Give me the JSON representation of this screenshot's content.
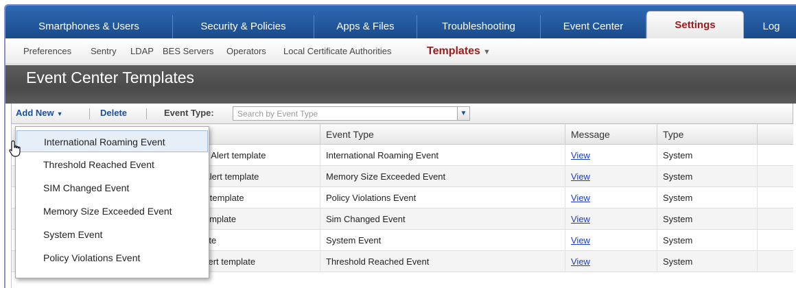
{
  "topnav": {
    "tabs": [
      {
        "label": "Smartphones & Users"
      },
      {
        "label": "Security & Policies"
      },
      {
        "label": "Apps & Files"
      },
      {
        "label": "Troubleshooting"
      },
      {
        "label": "Event Center"
      },
      {
        "label": "Settings"
      },
      {
        "label": "Log"
      }
    ],
    "active": "Settings"
  },
  "subnav": {
    "items": [
      {
        "label": "Preferences"
      },
      {
        "label": "Sentry"
      },
      {
        "label": "LDAP"
      },
      {
        "label": "BES Servers"
      },
      {
        "label": "Operators"
      },
      {
        "label": "Local Certificate Authorities"
      },
      {
        "label": "Templates"
      }
    ],
    "active": "Templates"
  },
  "page": {
    "title": "Event Center Templates"
  },
  "toolbar": {
    "add_new_label": "Add New",
    "delete_label": "Delete",
    "event_type_label": "Event Type:",
    "search_placeholder": "Search by Event Type"
  },
  "table": {
    "columns": [
      "Event Type",
      "Message",
      "Type"
    ],
    "rows": [
      {
        "name_fragment": "ing Alert template",
        "event_type": "International Roaming Event",
        "message": "View",
        "type": "System"
      },
      {
        "name_fragment": "d Alert template",
        "event_type": "Memory Size Exceeded Event",
        "message": "View",
        "type": "System"
      },
      {
        "name_fragment": "ert template",
        "event_type": "Policy Violations Event",
        "message": "View",
        "type": "System"
      },
      {
        "name_fragment": "t template",
        "event_type": "Sim Changed Event",
        "message": "View",
        "type": "System"
      },
      {
        "name_fragment": "plate",
        "event_type": "System Event",
        "message": "View",
        "type": "System"
      },
      {
        "id": "N/A",
        "name_fragment": "Default Threshold Reached Alert template",
        "event_type": "Threshold Reached Event",
        "message": "View",
        "type": "System"
      }
    ]
  },
  "add_new_menu": {
    "items": [
      {
        "label": "International Roaming Event"
      },
      {
        "label": "Threshold Reached Event"
      },
      {
        "label": "SIM Changed Event"
      },
      {
        "label": "Memory Size Exceeded Event"
      },
      {
        "label": "System Event"
      },
      {
        "label": "Policy Violations Event"
      }
    ],
    "hovered": "International Roaming Event"
  },
  "colors": {
    "nav_blue": "#1f5aa5",
    "active_tab_text": "#9b1b1b",
    "link_blue": "#1a3fc4",
    "title_band": "#4f4f4f"
  },
  "icons": [
    "hand-pointer-icon",
    "chevron-down-icon",
    "dropdown-arrow-icon"
  ]
}
